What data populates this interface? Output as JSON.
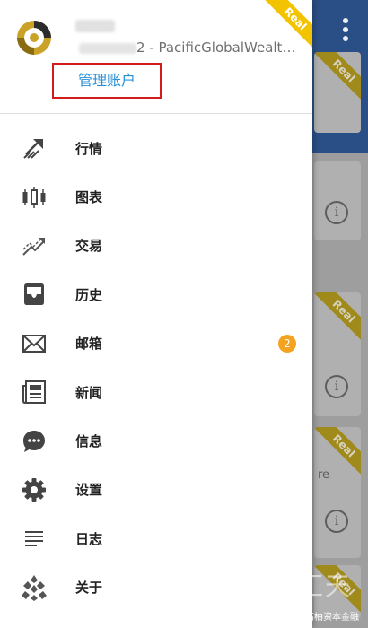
{
  "account": {
    "server_text": "2 - PacificGlobalWealth...",
    "real_tag": "Real",
    "manage_label": "管理账户"
  },
  "menu": {
    "items": [
      {
        "icon": "trend-arrow-icon",
        "label": "行情"
      },
      {
        "icon": "candlestick-chart-icon",
        "label": "图表"
      },
      {
        "icon": "trade-icon",
        "label": "交易"
      },
      {
        "icon": "inbox-tray-icon",
        "label": "历史"
      },
      {
        "icon": "envelope-icon",
        "label": "邮箱",
        "badge": "2"
      },
      {
        "icon": "newspaper-icon",
        "label": "新闻"
      },
      {
        "icon": "chat-bubble-icon",
        "label": "信息"
      },
      {
        "icon": "gear-icon",
        "label": "设置"
      },
      {
        "icon": "list-lines-icon",
        "label": "日志"
      },
      {
        "icon": "app-logo-icon",
        "label": "关于"
      }
    ]
  },
  "background": {
    "ribbon_label": "Real",
    "info_glyph": "i",
    "partial_text": "re"
  },
  "watermark": {
    "brand_text": "外汇天眼",
    "caption": "PGWC高柏资本金融"
  },
  "colors": {
    "header_bg": "#2a4f86",
    "real_tag": "#f3c300",
    "highlight_border": "#d21b1b",
    "link": "#2a90d8",
    "badge": "#f4a320"
  }
}
